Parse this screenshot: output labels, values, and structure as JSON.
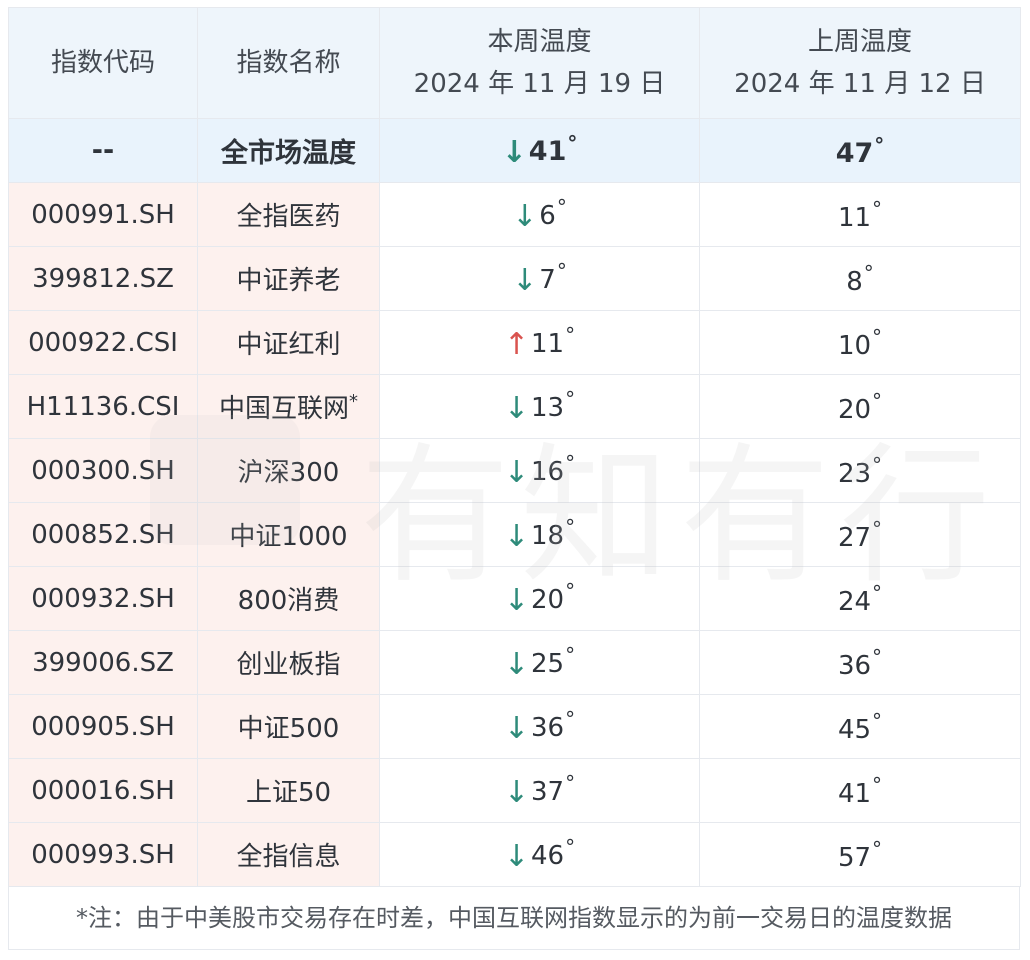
{
  "header": {
    "col_code": "指数代码",
    "col_name": "指数名称",
    "col_current": "本周温度",
    "col_current_date": "2024 年 11 月 19 日",
    "col_previous": "上周温度",
    "col_previous_date": "2024 年 11 月 12 日"
  },
  "market": {
    "code": "--",
    "name": "全市场温度",
    "current": "41",
    "current_direction": "down",
    "previous": "47"
  },
  "rows": [
    {
      "code": "000991.SH",
      "name": "全指医药",
      "current": "6",
      "direction": "down",
      "previous": "11",
      "note_mark": ""
    },
    {
      "code": "399812.SZ",
      "name": "中证养老",
      "current": "7",
      "direction": "down",
      "previous": "8",
      "note_mark": ""
    },
    {
      "code": "000922.CSI",
      "name": "中证红利",
      "current": "11",
      "direction": "up",
      "previous": "10",
      "note_mark": ""
    },
    {
      "code": "H11136.CSI",
      "name": "中国互联网",
      "current": "13",
      "direction": "down",
      "previous": "20",
      "note_mark": "*"
    },
    {
      "code": "000300.SH",
      "name": "沪深300",
      "current": "16",
      "direction": "down",
      "previous": "23",
      "note_mark": ""
    },
    {
      "code": "000852.SH",
      "name": "中证1000",
      "current": "18",
      "direction": "down",
      "previous": "27",
      "note_mark": ""
    },
    {
      "code": "000932.SH",
      "name": "800消费",
      "current": "20",
      "direction": "down",
      "previous": "24",
      "note_mark": ""
    },
    {
      "code": "399006.SZ",
      "name": "创业板指",
      "current": "25",
      "direction": "down",
      "previous": "36",
      "note_mark": ""
    },
    {
      "code": "000905.SH",
      "name": "中证500",
      "current": "36",
      "direction": "down",
      "previous": "45",
      "note_mark": ""
    },
    {
      "code": "000016.SH",
      "name": "上证50",
      "current": "37",
      "direction": "down",
      "previous": "41",
      "note_mark": ""
    },
    {
      "code": "000993.SH",
      "name": "全指信息",
      "current": "46",
      "direction": "down",
      "previous": "57",
      "note_mark": ""
    }
  ],
  "symbols": {
    "degree": "°",
    "arrow_down": "↓",
    "arrow_up": "↑"
  },
  "colors": {
    "arrow_down": "#2e8b7a",
    "arrow_up": "#d9534f",
    "header_bg": "#eef5fb",
    "left_cols_bg": "#fdf1ee"
  },
  "footnote": "*注：由于中美股市交易存在时差，中国互联网指数显示的为前一交易日的温度数据",
  "watermark": {
    "text": "有知有行",
    "logo_icon": "brand-logo-icon"
  }
}
